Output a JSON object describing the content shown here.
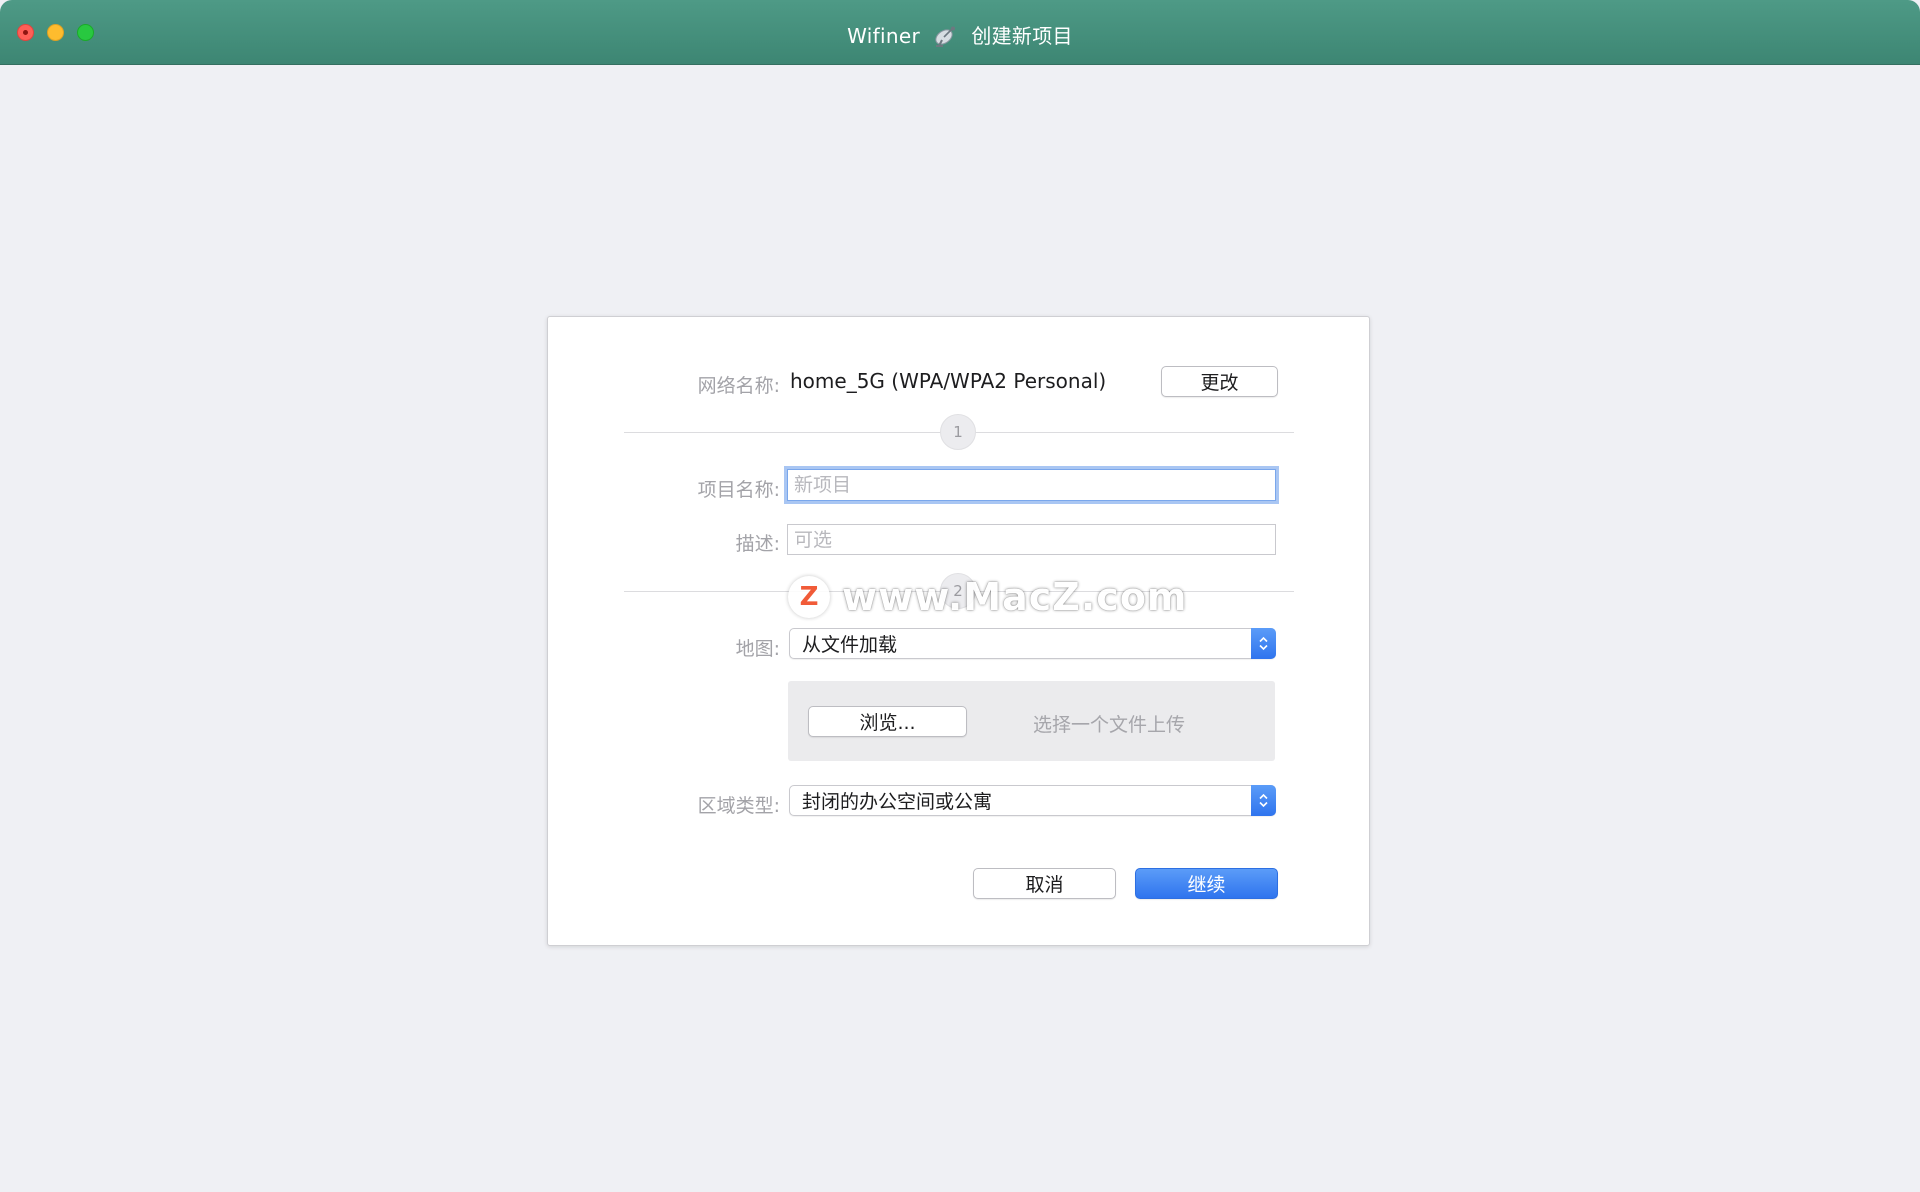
{
  "window": {
    "app_name": "Wifiner",
    "title_icon": "satellite-dish-icon",
    "title_suffix": "创建新项目"
  },
  "network": {
    "label": "网络名称:",
    "value": "home_5G (WPA/WPA2 Personal)",
    "change_button": "更改"
  },
  "steps": {
    "step1": "1",
    "step2": "2"
  },
  "project": {
    "name_label": "项目名称:",
    "name_placeholder": "新项目",
    "name_value": "",
    "desc_label": "描述:",
    "desc_placeholder": "可选",
    "desc_value": ""
  },
  "map": {
    "label": "地图:",
    "selected": "从文件加载",
    "browse_button": "浏览...",
    "file_hint": "选择一个文件上传"
  },
  "area": {
    "label": "区域类型:",
    "selected": "封闭的办公空间或公寓"
  },
  "actions": {
    "cancel": "取消",
    "continue": "继续"
  },
  "watermark": {
    "logo_letter": "Z",
    "text": "www.MacZ.com"
  },
  "colors": {
    "titlebar": "#46917d",
    "accent": "#2f74ee",
    "background": "#eff0f4"
  }
}
